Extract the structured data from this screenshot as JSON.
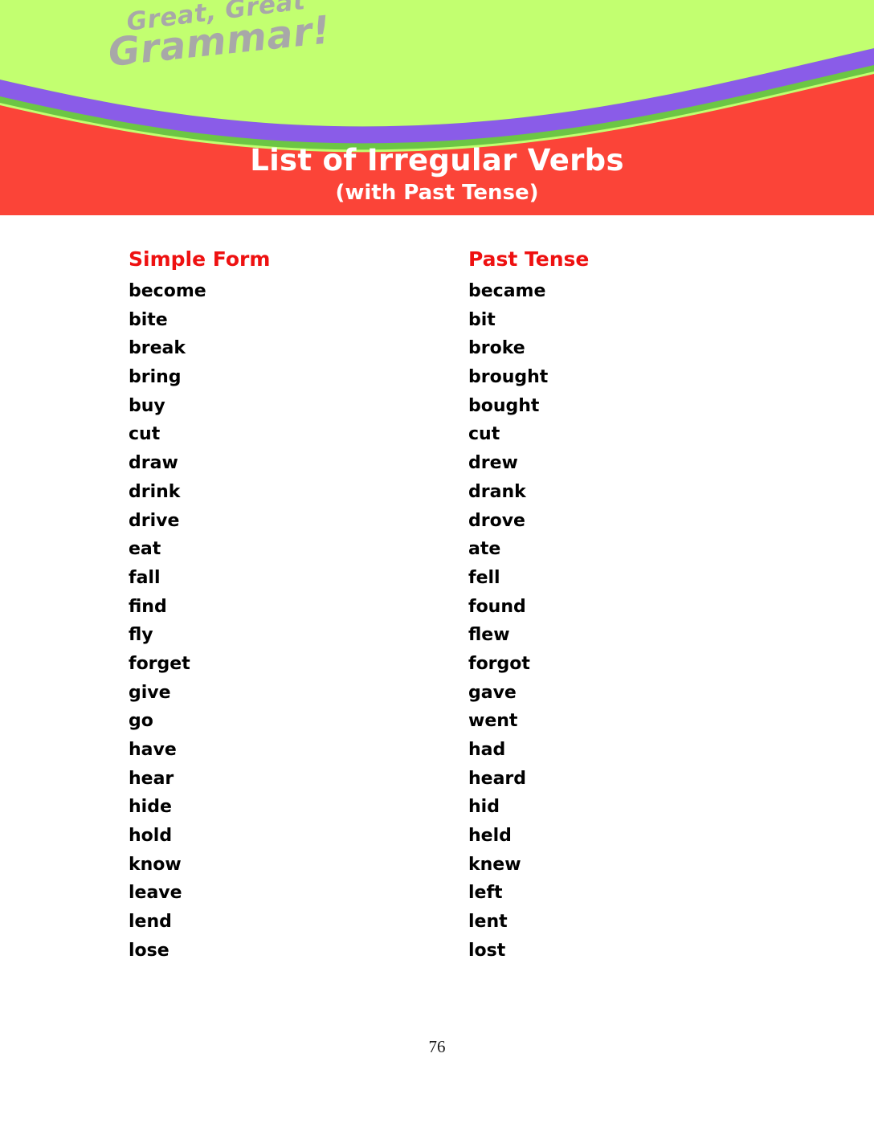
{
  "banner": {
    "logo": {
      "line1": "Great, Great",
      "line2": "Grammar!",
      "color": "#a8a8a8"
    },
    "title": "List of Irregular Verbs",
    "subtitle": "(with Past Tense)",
    "colors": {
      "lime": "#c2ff70",
      "purple": "#8a5ce8",
      "green": "#6cc644",
      "red": "#fb4438",
      "title_text": "#ffffff"
    }
  },
  "table": {
    "headers": {
      "simple_form": "Simple Form",
      "past_tense": "Past Tense",
      "color": "#ee1111"
    },
    "rows": [
      {
        "simple": "become",
        "past": "became"
      },
      {
        "simple": "bite",
        "past": "bit"
      },
      {
        "simple": "break",
        "past": "broke"
      },
      {
        "simple": "bring",
        "past": "brought"
      },
      {
        "simple": "buy",
        "past": "bought"
      },
      {
        "simple": "cut",
        "past": "cut"
      },
      {
        "simple": "draw",
        "past": "drew"
      },
      {
        "simple": "drink",
        "past": "drank"
      },
      {
        "simple": "drive",
        "past": "drove"
      },
      {
        "simple": "eat",
        "past": "ate"
      },
      {
        "simple": "fall",
        "past": "fell"
      },
      {
        "simple": "find",
        "past": "found"
      },
      {
        "simple": "fly",
        "past": "flew"
      },
      {
        "simple": "forget",
        "past": "forgot"
      },
      {
        "simple": "give",
        "past": "gave"
      },
      {
        "simple": "go",
        "past": "went"
      },
      {
        "simple": "have",
        "past": "had"
      },
      {
        "simple": "hear",
        "past": "heard"
      },
      {
        "simple": "hide",
        "past": "hid"
      },
      {
        "simple": "hold",
        "past": "held"
      },
      {
        "simple": "know",
        "past": "knew"
      },
      {
        "simple": "leave",
        "past": "left"
      },
      {
        "simple": "lend",
        "past": "lent"
      },
      {
        "simple": "lose",
        "past": "lost"
      }
    ]
  },
  "footer": {
    "page_number": "76"
  }
}
